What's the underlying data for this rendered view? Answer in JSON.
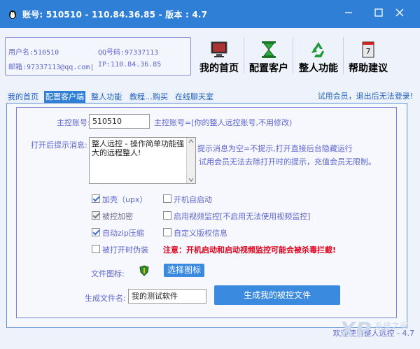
{
  "window": {
    "title": "账号: 510510 - 110.84.36.85 - 版本 : 4.7",
    "controls": [
      "minimize",
      "maximize",
      "close"
    ]
  },
  "account_info": {
    "username": "用户名:510510",
    "qq": "QQ号码:97337113",
    "email": "邮箱:97337113@qq.com|",
    "ip": "IP:110.84.36.85"
  },
  "top_buttons": [
    {
      "label": "我的首页",
      "icon": "home-monitor-icon"
    },
    {
      "label": "配置客户",
      "icon": "hourglass-icon"
    },
    {
      "label": "整人功能",
      "icon": "recycle-icon"
    },
    {
      "label": "帮助建议",
      "icon": "help-book-icon"
    }
  ],
  "tabs": [
    {
      "label": "我的首页",
      "active": false
    },
    {
      "label": "配置客户端",
      "active": true
    },
    {
      "label": "整人功能",
      "active": false
    },
    {
      "label": "教程…购买",
      "active": false
    },
    {
      "label": "在线聊天室",
      "active": false
    }
  ],
  "trial_notice": "试用会员，退出后无法登录!",
  "form": {
    "account_label": "主控账号:",
    "account_value": "510510",
    "account_hint": "主控账号=[你的整人远控账号,不用修改)",
    "prompt_label": "打开后提示消息:",
    "prompt_value": "整人远控 - 操作简单功能强大的远程整人!",
    "prompt_hint_1": "提示消息为空=不提示,打开直接后台隐藏运行",
    "prompt_hint_2": "试用会员无法去除打开时的提示，充值会员无限制。",
    "options": [
      {
        "label": "加壳（upx）",
        "checked": true,
        "enabled": true
      },
      {
        "label": "开机自启动",
        "checked": false,
        "enabled": true
      },
      {
        "label": "被控加密",
        "checked": true,
        "enabled": false
      },
      {
        "label": "启用视频监控[不启用无法使用视频监控]",
        "checked": false,
        "enabled": true
      },
      {
        "label": "自动zip压缩",
        "checked": true,
        "enabled": true
      },
      {
        "label": "自定义版权信息",
        "checked": false,
        "enabled": true
      },
      {
        "label": "被打开时伪装",
        "checked": false,
        "enabled": true
      }
    ],
    "warning": "注意：开机启动和启动视频监控可能会被杀毒拦截!",
    "file_icon_label": "文件图标:",
    "choose_icon_button": "选择图标",
    "filename_label": "生成文件名:",
    "filename_value": "我的测试软件",
    "generate_button": "生成我的被控文件"
  },
  "footer": {
    "version": "欢迎使用整人远控 - 4.7",
    "watermark": "系统之家"
  },
  "colors": {
    "titlebar": "#2f7fd6",
    "label": "#5f65d1",
    "warning": "#e0001b",
    "button": "#3a8ae0"
  }
}
